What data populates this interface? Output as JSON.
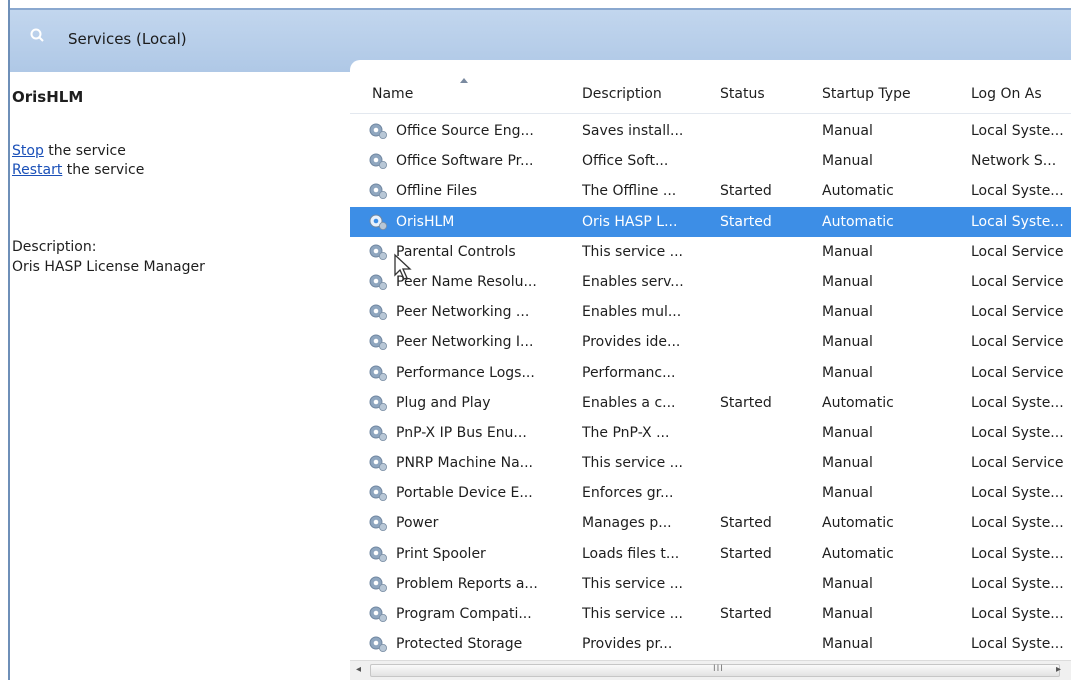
{
  "window": {
    "title": "Services (Local)",
    "icon": "magnifier-gear-icon"
  },
  "left_pane": {
    "service_name": "OrisHLM",
    "actions": [
      {
        "link": "Stop",
        "rest": " the service"
      },
      {
        "link": "Restart",
        "rest": " the service"
      }
    ],
    "description_label": "Description:",
    "description": "Oris HASP License Manager"
  },
  "columns": [
    "Name",
    "Description",
    "Status",
    "Startup Type",
    "Log On As"
  ],
  "rows": [
    {
      "name": "Office  Source Eng...",
      "description": "Saves install...",
      "status": "",
      "startup": "Manual",
      "logon": "Local Syste..."
    },
    {
      "name": "Office Software Pr...",
      "description": "Office Soft...",
      "status": "",
      "startup": "Manual",
      "logon": "Network S..."
    },
    {
      "name": "Offline Files",
      "description": "The Offline ...",
      "status": "Started",
      "startup": "Automatic",
      "logon": "Local Syste..."
    },
    {
      "name": "OrisHLM",
      "description": "Oris HASP L...",
      "status": "Started",
      "startup": "Automatic",
      "logon": "Local Syste...",
      "selected": true
    },
    {
      "name": "Parental Controls",
      "description": "This service ...",
      "status": "",
      "startup": "Manual",
      "logon": "Local Service"
    },
    {
      "name": "Peer Name Resolu...",
      "description": "Enables serv...",
      "status": "",
      "startup": "Manual",
      "logon": "Local Service"
    },
    {
      "name": "Peer Networking ...",
      "description": "Enables mul...",
      "status": "",
      "startup": "Manual",
      "logon": "Local Service"
    },
    {
      "name": "Peer Networking I...",
      "description": "Provides ide...",
      "status": "",
      "startup": "Manual",
      "logon": "Local Service"
    },
    {
      "name": "Performance Logs...",
      "description": "Performanc...",
      "status": "",
      "startup": "Manual",
      "logon": "Local Service"
    },
    {
      "name": "Plug and Play",
      "description": "Enables a c...",
      "status": "Started",
      "startup": "Automatic",
      "logon": "Local Syste..."
    },
    {
      "name": "PnP-X IP Bus Enu...",
      "description": "The PnP-X ...",
      "status": "",
      "startup": "Manual",
      "logon": "Local Syste..."
    },
    {
      "name": "PNRP Machine Na...",
      "description": "This service ...",
      "status": "",
      "startup": "Manual",
      "logon": "Local Service"
    },
    {
      "name": "Portable Device E...",
      "description": "Enforces gr...",
      "status": "",
      "startup": "Manual",
      "logon": "Local Syste..."
    },
    {
      "name": "Power",
      "description": "Manages p...",
      "status": "Started",
      "startup": "Automatic",
      "logon": "Local Syste..."
    },
    {
      "name": "Print Spooler",
      "description": "Loads files t...",
      "status": "Started",
      "startup": "Automatic",
      "logon": "Local Syste..."
    },
    {
      "name": "Problem Reports a...",
      "description": "This service ...",
      "status": "",
      "startup": "Manual",
      "logon": "Local Syste..."
    },
    {
      "name": "Program Compati...",
      "description": "This service ...",
      "status": "Started",
      "startup": "Manual",
      "logon": "Local Syste..."
    },
    {
      "name": "Protected Storage",
      "description": "Provides pr...",
      "status": "",
      "startup": "Manual",
      "logon": "Local Syste..."
    }
  ],
  "colors": {
    "selection": "#3d8ee6",
    "title_bar": "#b7cde9",
    "link": "#1a50b8"
  },
  "scrollbar": {
    "grip": "III",
    "left_arrow": "◂",
    "right_arrow": "▸"
  }
}
